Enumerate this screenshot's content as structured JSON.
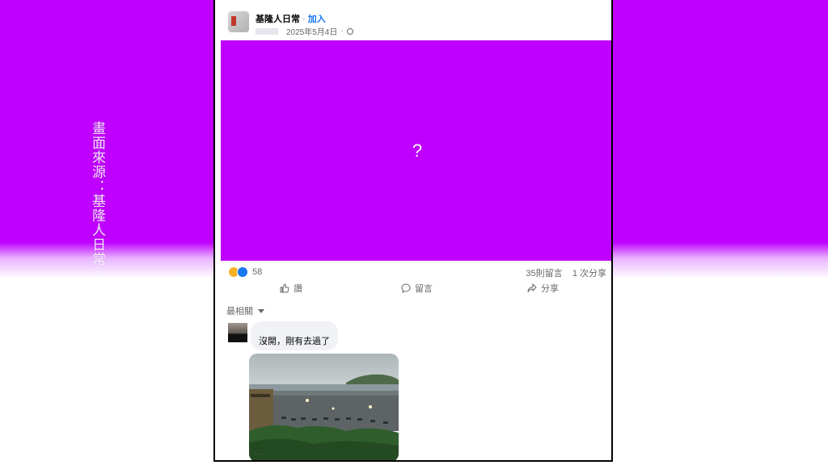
{
  "side_caption": "畫面來源：基隆人日常",
  "post": {
    "page_name": "基隆人日常",
    "separator": "·",
    "join_label": "加入",
    "date": "2025年5月4日",
    "media_placeholder": "?"
  },
  "stats": {
    "reaction_count": "58",
    "comments": "35則留言",
    "shares": "1 次分享"
  },
  "actions": {
    "like": "讚",
    "comment": "留言",
    "share": "分享"
  },
  "sort_label": "最相關",
  "comment": {
    "text": "沒開，剛有去過了"
  },
  "colors": {
    "accent": "#1877f2",
    "background_magenta": "#bf00ff"
  }
}
